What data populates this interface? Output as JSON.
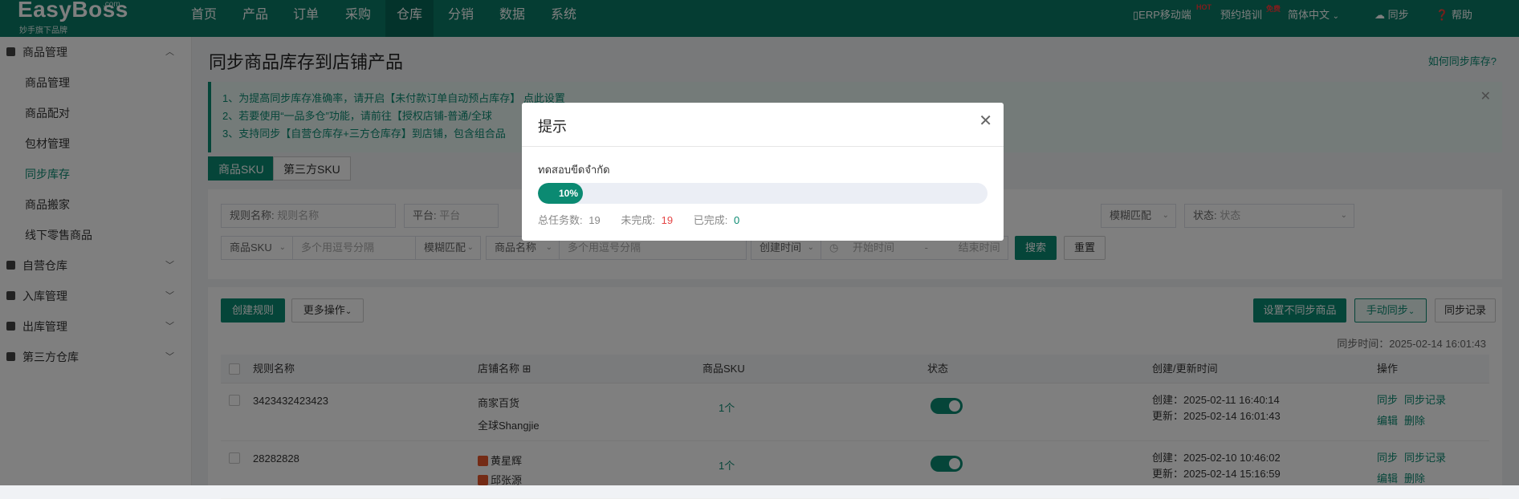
{
  "header": {
    "logo": "EasyBoss",
    "logo_com": ".com",
    "logo_sub": "妙手旗下品牌",
    "nav": [
      "首页",
      "产品",
      "订单",
      "采购",
      "仓库",
      "分销",
      "数据",
      "系统"
    ],
    "nav_active": "仓库",
    "erp_mobile": "ERP移动端",
    "erp_badge": "HOT",
    "training": "预约培训",
    "training_badge": "免费",
    "language": "简体中文",
    "sync": "同步",
    "help": "帮助"
  },
  "sidebar": {
    "groups": [
      {
        "label": "商品管理",
        "expanded": true
      },
      {
        "label": "自营仓库"
      },
      {
        "label": "入库管理"
      },
      {
        "label": "出库管理"
      },
      {
        "label": "第三方仓库"
      }
    ],
    "items": [
      "商品管理",
      "商品配对",
      "包材管理",
      "同步库存",
      "商品搬家",
      "线下零售商品"
    ],
    "active_item": "同步库存"
  },
  "main": {
    "title": "同步商品库存到店铺产品",
    "help_link": "如何同步库存?",
    "notice": [
      "1、为提高同步库存准确率，请开启【未付款订单自动预占库存】    点此设置",
      "2、若要使用“一品多仓”功能，请前往【授权店铺-普通/全球",
      "3、支持同步【自营仓库存+三方仓库存】到店铺，包含组合品"
    ],
    "tabs": [
      "商品SKU",
      "第三方SKU"
    ],
    "active_tab": "商品SKU",
    "filters": {
      "rule_name_label": "规则名称:",
      "rule_name_placeholder": "规则名称",
      "platform_label": "平台:",
      "platform_placeholder": "平台",
      "fuzzy_match": "模糊匹配",
      "status_label": "状态:",
      "status_placeholder": "状态",
      "sku_select": "商品SKU",
      "sku_placeholder": "多个用逗号分隔",
      "fuzzy_match2": "模糊匹配",
      "name_select": "商品名称",
      "name_placeholder": "多个用逗号分隔",
      "time_select": "创建时间",
      "start_placeholder": "开始时间",
      "range_sep": "-",
      "end_placeholder": "结束时间",
      "search": "搜索",
      "reset": "重置"
    },
    "actions": {
      "create_rule": "创建规则",
      "more_ops": "更多操作",
      "set_no_sync": "设置不同步商品",
      "manual_sync": "手动同步",
      "sync_log": "同步记录"
    },
    "sync_time_label": "同步时间：",
    "sync_time": "2025-02-14 16:01:43",
    "table": {
      "columns": [
        "规则名称",
        "店铺名称",
        "商品SKU",
        "状态",
        "创建/更新时间",
        "操作"
      ],
      "rows": [
        {
          "rule_name": "3423432423423",
          "shop1": "商家百货",
          "shop2": "全球Shangjie",
          "sku": "1个",
          "status_on": true,
          "created": "创建：2025-02-11 16:40:14",
          "updated": "更新：2025-02-14 16:01:43",
          "ops": [
            "同步",
            "同步记录",
            "编辑",
            "删除"
          ]
        },
        {
          "rule_name": "28282828",
          "shop1": "黄星辉",
          "shop2": "邱张源",
          "sku": "1个",
          "status_on": true,
          "created": "创建：2025-02-10 10:46:02",
          "updated": "更新：2025-02-14 15:16:59",
          "ops": [
            "同步",
            "同步记录",
            "编辑",
            "删除"
          ]
        }
      ]
    }
  },
  "modal": {
    "title": "提示",
    "message": "ทดสอบขีดจำกัด",
    "progress": 10,
    "progress_text": "10%",
    "total_label": "总任务数:",
    "total": "19",
    "pending_label": "未完成:",
    "pending": "19",
    "done_label": "已完成:",
    "done": "0",
    "colors": {
      "accent": "#0b8a72",
      "pending": "#e54545",
      "done": "#0b8a72"
    }
  }
}
